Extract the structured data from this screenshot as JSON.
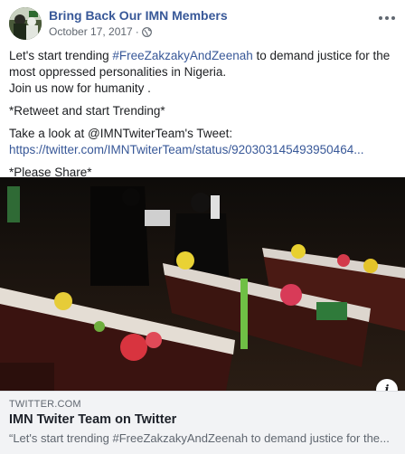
{
  "post": {
    "page_name": "Bring Back Our IMN Members",
    "date": "October 17, 2017",
    "separator": "·",
    "privacy_icon": "globe-icon",
    "more_icon": "ellipsis-icon",
    "text": {
      "line1_before": "Let's start trending ",
      "hashtag": "#FreeZakzakyAndZeenah",
      "line1_after": " to demand justice for the most oppressed personalities in Nigeria.",
      "line2": "Join us now for humanity .",
      "line3": "*Retweet and start Trending*",
      "line4": "Take a look at @IMNTwiterTeam's Tweet:",
      "link": "https://twitter.com/IMNTwiterTeam/status/920303145493950464...",
      "line5": "*Please Share*"
    }
  },
  "link_card": {
    "domain": "TWITTER.COM",
    "title": "IMN Twiter Team on Twitter",
    "description": "“Let's start trending #FreeZakzakyAndZeenah to demand justice for the...",
    "info_icon": "info-icon",
    "info_glyph": "i"
  },
  "colors": {
    "link": "#385898",
    "meta": "#606770",
    "card_bg": "#f2f3f5"
  }
}
